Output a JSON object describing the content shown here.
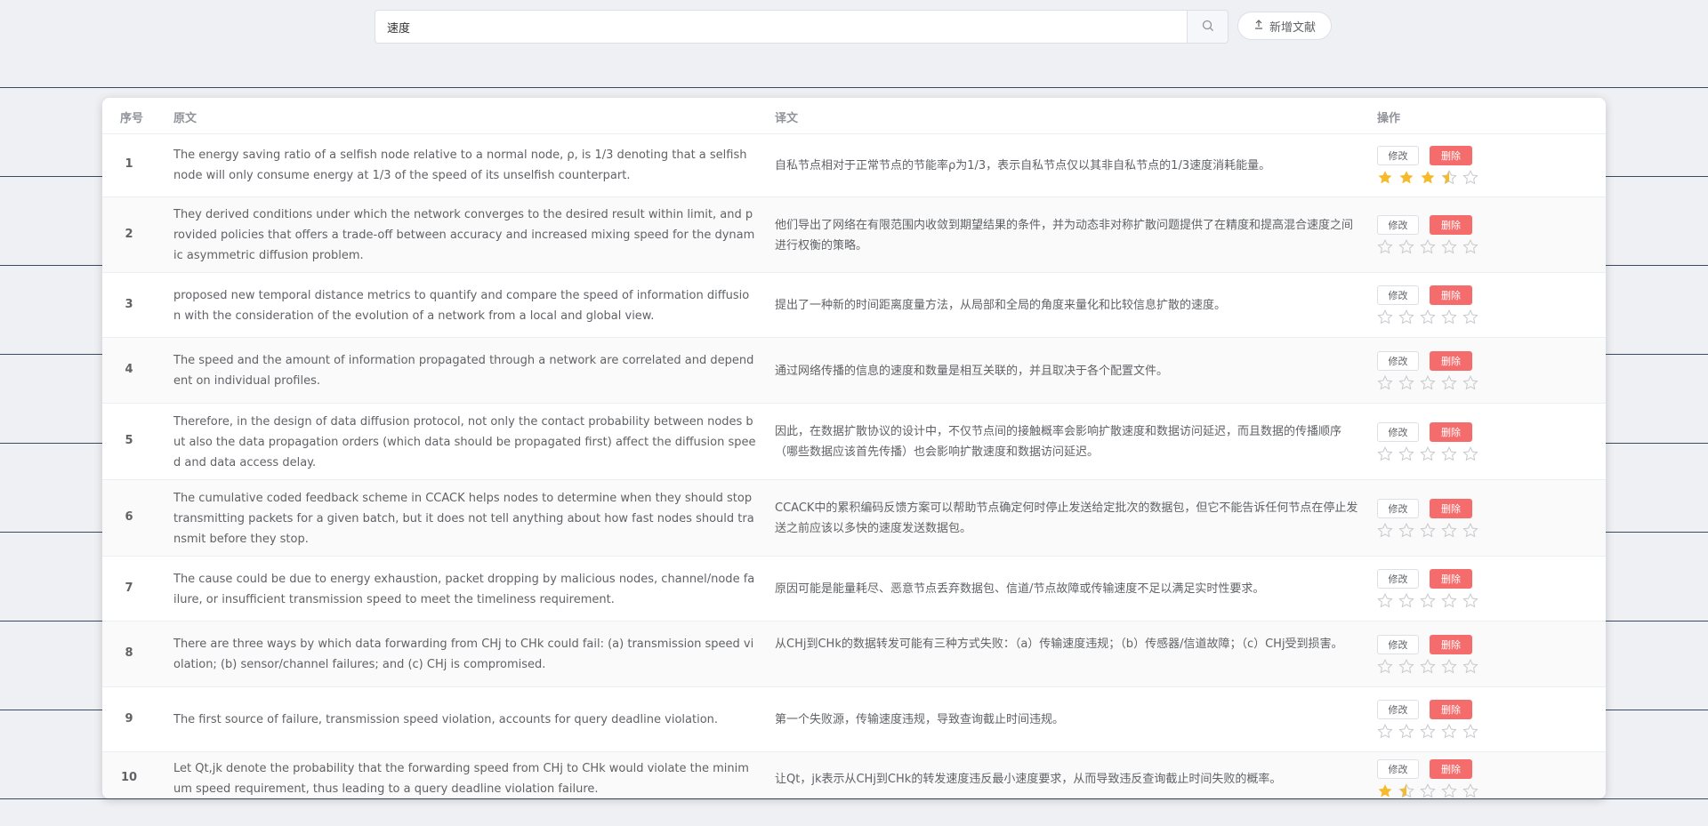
{
  "search": {
    "value": "速度"
  },
  "toolbar": {
    "add_label": "新增文献"
  },
  "table": {
    "headers": {
      "index": "序号",
      "original": "原文",
      "translation": "译文",
      "actions": "操作"
    },
    "edit_label": "修改",
    "delete_label": "删除",
    "rows": [
      {
        "index": "1",
        "original": "The energy saving ratio of a selfish node relative to a normal node, ρ, is 1/3 denoting that a selfish node will only consume energy at 1/3 of the speed of its unselfish counterpart.",
        "translation": "自私节点相对于正常节点的节能率ρ为1/3，表示自私节点仅以其非自私节点的1/3速度消耗能量。",
        "rating": 3.5
      },
      {
        "index": "2",
        "original": "They derived conditions under which the network converges to the desired result within limit, and provided policies that offers a trade-off between accuracy and increased mixing speed for the dynamic asymmetric diffusion problem.",
        "translation": "他们导出了网络在有限范围内收敛到期望结果的条件，并为动态非对称扩散问题提供了在精度和提高混合速度之间进行权衡的策略。",
        "rating": 0
      },
      {
        "index": "3",
        "original": "proposed new temporal distance metrics to quantify and compare the speed of information diffusion with the consideration of the evolution of a network from a local and global view.",
        "translation": "提出了一种新的时间距离度量方法，从局部和全局的角度来量化和比较信息扩散的速度。",
        "rating": 0
      },
      {
        "index": "4",
        "original": "The speed and the amount of information propagated through a network are correlated and dependent on individual profiles.",
        "translation": "通过网络传播的信息的速度和数量是相互关联的，并且取决于各个配置文件。",
        "rating": 0
      },
      {
        "index": "5",
        "original": "Therefore, in the design of data diffusion protocol, not only the contact probability between nodes but also the data propagation orders (which data should be propagated first) affect the diffusion speed and data access delay.",
        "translation": "因此，在数据扩散协议的设计中，不仅节点间的接触概率会影响扩散速度和数据访问延迟，而且数据的传播顺序（哪些数据应该首先传播）也会影响扩散速度和数据访问延迟。",
        "rating": 0
      },
      {
        "index": "6",
        "original": "The cumulative coded feedback scheme in CCACK helps nodes to determine when they should stop transmitting packets for a given batch, but it does not tell anything about how fast nodes should transmit before they stop.",
        "translation": "CCACK中的累积编码反馈方案可以帮助节点确定何时停止发送给定批次的数据包，但它不能告诉任何节点在停止发送之前应该以多快的速度发送数据包。",
        "rating": 0
      },
      {
        "index": "7",
        "original": "The cause could be due to energy exhaustion, packet dropping by malicious nodes, channel/node failure, or insufficient transmission speed to meet the timeliness requirement.",
        "translation": "原因可能是能量耗尽、恶意节点丢弃数据包、信道/节点故障或传输速度不足以满足实时性要求。",
        "rating": 0
      },
      {
        "index": "8",
        "original": "There are three ways by which data forwarding from CHj to CHk could fail: (a) transmission speed violation; (b) sensor/channel failures; and (c) CHj is compromised.",
        "translation": "从CHj到CHk的数据转发可能有三种方式失败：（a）传输速度违规；（b）传感器/信道故障；（c）CHj受到损害。",
        "rating": 0
      },
      {
        "index": "9",
        "original": "The first source of failure, transmission speed violation, accounts for query deadline violation.",
        "translation": "第一个失败源，传输速度违规，导致查询截止时间违规。",
        "rating": 0
      },
      {
        "index": "10",
        "original": "Let Qt,jk denote the probability that the forwarding speed from CHj to CHk would violate the minimum speed requirement, thus leading to a query deadline violation failure.",
        "translation": "让Qt，jk表示从CHj到CHk的转发速度违反最小速度要求，从而导致违反查询截止时间失败的概率。",
        "rating": 1.5
      }
    ]
  },
  "colors": {
    "star_active": "#f7ba2a",
    "star_inactive": "#c6c8cc",
    "danger": "#f56c6c"
  },
  "icons": {
    "search": "search-icon",
    "upload": "upload-icon",
    "star": "star-icon"
  }
}
